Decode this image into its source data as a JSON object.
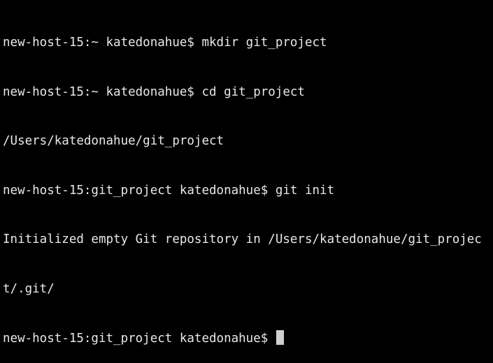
{
  "terminal": {
    "lines": [
      "new-host-15:~ katedonahue$ mkdir git_project",
      "new-host-15:~ katedonahue$ cd git_project",
      "/Users/katedonahue/git_project",
      "new-host-15:git_project katedonahue$ git init",
      "Initialized empty Git repository in /Users/katedonahue/git_projec",
      "t/.git/"
    ],
    "prompt": "new-host-15:git_project katedonahue$ "
  },
  "colors": {
    "background": "#000000",
    "text": "#e8e8e8",
    "cursor": "#cfcfcf"
  }
}
